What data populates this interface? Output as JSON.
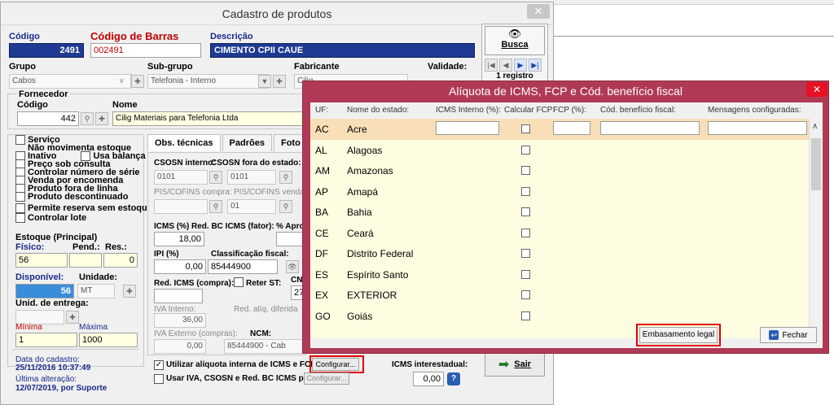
{
  "main": {
    "title": "Cadastro de produtos",
    "close": "✕",
    "codigo_label": "Código",
    "codigo": "2491",
    "barras_label": "Código de Barras",
    "barras": "002491",
    "descricao_label": "Descrição",
    "descricao": "CIMENTO CPII CAUE",
    "grupo_label": "Grupo",
    "grupo": "Cabos",
    "subgrupo_label": "Sub-grupo",
    "subgrupo": "Telefonia - Interno",
    "fabricante_label": "Fabricante",
    "fabricante": "Cilig",
    "validade_label": "Validade:",
    "fornecedor_label": "Fornecedor",
    "forn_codigo_label": "Código",
    "forn_nome_label": "Nome",
    "forn_codigo": "442",
    "forn_nome": "Cilig Materiais para Telefonia Ltda",
    "busca_label": "Busca",
    "registros": "1 registro",
    "checks": [
      "Serviço",
      "Não movimenta estoque",
      "Inativo",
      "Usa balança",
      "Preço sob consulta",
      "Controlar número de série",
      "Venda por encomenda",
      "Produto fora de linha",
      "Produto descontinuado",
      "Permite reserva sem estoque",
      "Controlar lote"
    ],
    "estoque_label": "Estoque (Principal)",
    "fisico_label": "Físico:",
    "pend_label": "Pend.:",
    "res_label": "Res.:",
    "fisico": "56",
    "res": "0",
    "disponivel_label": "Disponível:",
    "disponivel": "56",
    "unidade_label": "Unidade:",
    "unidade": "MT",
    "unid_entrega_label": "Unid. de entrega:",
    "minima_label": "Mínima",
    "maxima_label": "Máxima",
    "minima": "1",
    "maxima": "1000",
    "data_cadastro_label": "Data do cadastro:",
    "data_cadastro": "25/11/2016 10:37:49",
    "ultima_alt_label": "Última alteração:",
    "ultima_alt": "12/07/2019, por Suporte",
    "tabs": [
      "Obs. técnicas",
      "Padrões",
      "Foto"
    ],
    "csosn_int_label": "CSOSN interno:",
    "csosn_fora_label": "CSOSN fora do estado:",
    "csosn_int": "0101",
    "csosn_fora": "0101",
    "pis_compra_label": "PIS/COFINS compra:",
    "pis_venda_label": "PIS/COFINS venda:",
    "pis_venda": "01",
    "icms_label": "ICMS (%)",
    "red_bc_label": "Red. BC ICMS (fator):",
    "aprox_label": "% Apro",
    "icms": "18,00",
    "ipi_label": "IPI (%)",
    "class_fiscal_label": "Classificação fiscal:",
    "ipi": "0,00",
    "class_fiscal": "85444900",
    "red_icms_compra_label": "Red. ICMS (compra):",
    "reter_st_label": "Reter ST:",
    "cn_label": "CN",
    "cn_val": "27",
    "iva_interno_label": "IVA Interno:",
    "red_aliq_label": "Red. alíq. diferida",
    "iva_interno": "36,00",
    "iva_externo_label": "IVA Externo (compras):",
    "ncm_label": "NCM:",
    "iva_externo": "0,00",
    "ncm": "85444900 - Cab",
    "utilizar_label": "Utilizar alíquota interna de ICMS e FCP:",
    "configurar": "Configurar...",
    "usar_iva_label": "Usar IVA, CSOSN e Red. BC ICMS por",
    "icms_inter_label": "ICMS interestadual:",
    "icms_inter": "0,00",
    "sair": "Sair"
  },
  "dialog": {
    "title": "Alíquota de ICMS, FCP e Cód. benefício fiscal",
    "close": "✕",
    "headers": {
      "uf": "UF:",
      "nome": "Nome do estado:",
      "icms": "ICMS Interno (%):",
      "calc": "Calcular FCP:",
      "fcp": "FCP (%):",
      "cod": "Cód. benefício fiscal:",
      "msg": "Mensagens configuradas:"
    },
    "rows": [
      {
        "uf": "AC",
        "nome": "Acre"
      },
      {
        "uf": "AL",
        "nome": "Alagoas"
      },
      {
        "uf": "AM",
        "nome": "Amazonas"
      },
      {
        "uf": "AP",
        "nome": "Amapá"
      },
      {
        "uf": "BA",
        "nome": "Bahia"
      },
      {
        "uf": "CE",
        "nome": "Ceará"
      },
      {
        "uf": "DF",
        "nome": "Distrito Federal"
      },
      {
        "uf": "ES",
        "nome": "Espírito Santo"
      },
      {
        "uf": "EX",
        "nome": "EXTERIOR"
      },
      {
        "uf": "GO",
        "nome": "Goiás"
      }
    ],
    "embasamento": "Embasamento legal",
    "fechar": "Fechar"
  },
  "colors": {
    "dialog_frame": "#b03a55",
    "grid_bg": "#fffde1",
    "selected_row": "#f8dfb8",
    "highlight_box": "#e00000",
    "description_bg": "#1f3a93"
  }
}
